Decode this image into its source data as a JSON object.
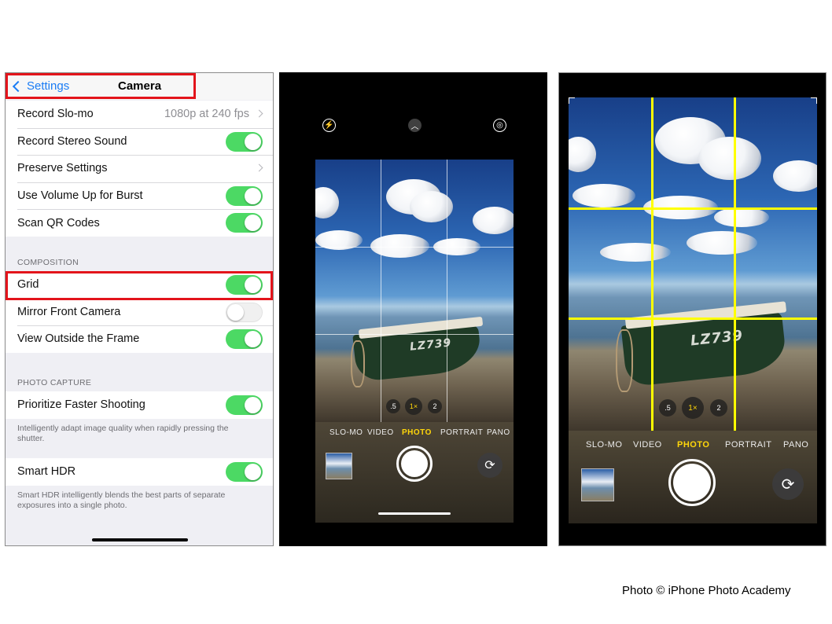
{
  "settings": {
    "back_label": "Settings",
    "title": "Camera",
    "group1": [
      {
        "label": "Record Slo-mo",
        "value": "1080p at 240 fps",
        "control": "disclosure"
      },
      {
        "label": "Record Stereo Sound",
        "control": "toggle-on"
      },
      {
        "label": "Preserve Settings",
        "control": "disclosure"
      },
      {
        "label": "Use Volume Up for Burst",
        "control": "toggle-on"
      },
      {
        "label": "Scan QR Codes",
        "control": "toggle-on"
      }
    ],
    "composition_header": "COMPOSITION",
    "group2": [
      {
        "label": "Grid",
        "control": "toggle-on"
      },
      {
        "label": "Mirror Front Camera",
        "control": "toggle-off"
      },
      {
        "label": "View Outside the Frame",
        "control": "toggle-on"
      }
    ],
    "photo_capture_header": "PHOTO CAPTURE",
    "group3": [
      {
        "label": "Prioritize Faster Shooting",
        "control": "toggle-on"
      }
    ],
    "faster_shooting_note": "Intelligently adapt image quality when rapidly pressing the shutter.",
    "group4": [
      {
        "label": "Smart HDR",
        "control": "toggle-on"
      }
    ],
    "smart_hdr_note": "Smart HDR intelligently blends the best parts of separate exposures into a single photo.",
    "highlight_color": "#e3141b",
    "toggle_on_color": "#4cd964",
    "link_color": "#1a7cf5"
  },
  "camera": {
    "modes": [
      "SLO-MO",
      "VIDEO",
      "PHOTO",
      "PORTRAIT",
      "PANO"
    ],
    "active_mode": "PHOTO",
    "zoom_levels": [
      ".5",
      "1×",
      "2"
    ],
    "active_zoom": "1×",
    "boat_registration": "LZ739",
    "grid_color_panel2": "#ffffff",
    "grid_color_panel3": "#ffff00",
    "active_color": "#ffd60a",
    "icons": [
      "flash-icon",
      "chevron-up-icon",
      "live-photo-icon",
      "flip-camera-icon"
    ]
  },
  "credit": "Photo © iPhone Photo Academy"
}
